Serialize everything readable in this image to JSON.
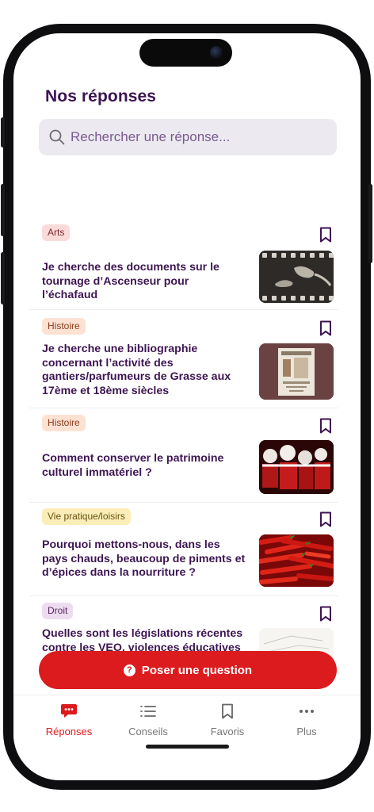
{
  "page": {
    "title": "Nos réponses",
    "search": {
      "placeholder": "Rechercher une réponse..."
    }
  },
  "items": [
    {
      "tag": "Arts",
      "tag_colors": {
        "bg": "#fbdada",
        "fg": "#7a2a2a"
      },
      "title": "Je cherche des documents sur le tournage d’Ascenseur pour l’échafaud",
      "thumbnail": "film-strip-photo"
    },
    {
      "tag": "Histoire",
      "tag_colors": {
        "bg": "#fde2d3",
        "fg": "#8a3a1a"
      },
      "title": "Je cherche une bibliographie concernant l’activité des gantiers/parfumeurs de Grasse aux 17ème et 18ème siècles",
      "thumbnail": "engraving-illustration"
    },
    {
      "tag": "Histoire",
      "tag_colors": {
        "bg": "#fde2d3",
        "fg": "#8a3a1a"
      },
      "title": "Comment conserver le patrimoine culturel immatériel ?",
      "thumbnail": "carnival-masks-photo"
    },
    {
      "tag": "Vie pratique/loisirs",
      "tag_colors": {
        "bg": "#fbedb8",
        "fg": "#6a5210"
      },
      "title": "Pourquoi mettons-nous, dans les pays chauds, beaucoup de piments et d’épices dans la nourriture ?",
      "thumbnail": "red-chili-peppers-photo"
    },
    {
      "tag": "Droit",
      "tag_colors": {
        "bg": "#eddcef",
        "fg": "#5a2a60"
      },
      "title": "Quelles sont les législations récentes contre les VEO, violences éducatives",
      "thumbnail": "sketch-drawing"
    }
  ],
  "cta": {
    "label": "Poser une question",
    "icon": "question-circle-icon"
  },
  "tabbar": {
    "tabs": [
      {
        "label": "Réponses",
        "icon": "chat-bubble-icon",
        "active": true
      },
      {
        "label": "Conseils",
        "icon": "list-icon",
        "active": false
      },
      {
        "label": "Favoris",
        "icon": "bookmark-icon",
        "active": false
      },
      {
        "label": "Plus",
        "icon": "more-dots-icon",
        "active": false
      }
    ]
  },
  "colors": {
    "accent": "#dc1b1e",
    "title_text": "#3d1552",
    "search_bg": "#eceaf0",
    "inactive_tab": "#777777"
  }
}
